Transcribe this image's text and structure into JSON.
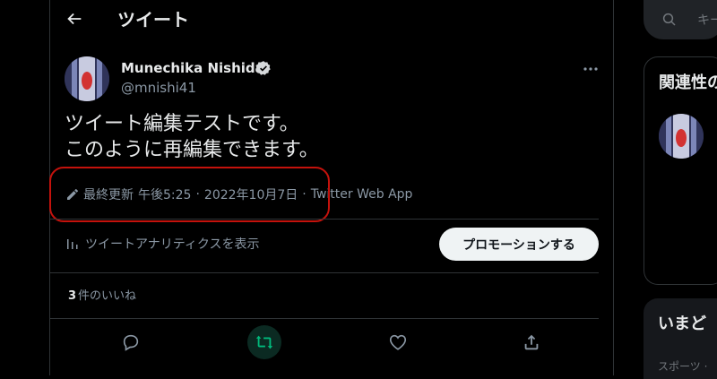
{
  "header": {
    "title": "ツイート"
  },
  "tweet": {
    "author_name": "Munechika Nishida",
    "author_handle": "@mnishi41",
    "text_line1": "ツイート編集テストです。",
    "text_line2": "このように再編集できます。",
    "edited_label": "最終更新",
    "time": "午後5:25",
    "date": "2022年10月7日",
    "separator": "·",
    "source": "Twitter Web App"
  },
  "analytics": {
    "label": "ツイートアナリティクスを表示",
    "promote_button": "プロモーションする"
  },
  "engagement": {
    "likes_count": "3",
    "likes_label": "件のいいね"
  },
  "sidebar": {
    "search_placeholder": "キー",
    "related_title": "関連性の",
    "trends_title": "いまど",
    "trends_category": "スポーツ ·"
  },
  "colors": {
    "background": "#000000",
    "text": "#e7e9ea",
    "secondary_text": "#8b98a5",
    "border": "#2f3336",
    "retweet_active": "#00ba7c",
    "annotation_red": "#c4120c"
  },
  "icons": [
    "back-arrow-icon",
    "verified-badge-icon",
    "more-icon",
    "pencil-icon",
    "analytics-icon",
    "reply-icon",
    "retweet-icon",
    "like-icon",
    "share-icon",
    "search-icon"
  ]
}
